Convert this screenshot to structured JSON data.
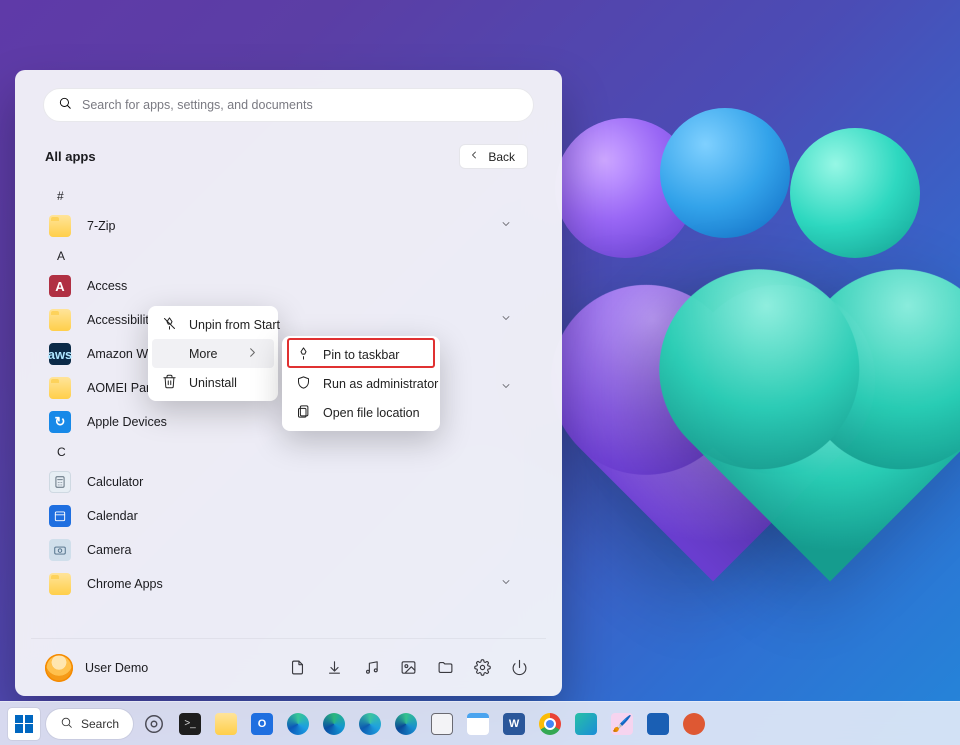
{
  "search": {
    "placeholder": "Search for apps, settings, and documents"
  },
  "header": {
    "title": "All apps",
    "back": "Back"
  },
  "letters": {
    "hash": "#",
    "a": "A",
    "c": "C"
  },
  "apps": {
    "sevenzip": "7-Zip",
    "access": "Access",
    "accessibility": "Accessibility",
    "amazon": "Amazon Workspaces",
    "aomei": "AOMEI Partition Assistant",
    "apple": "Apple Devices",
    "calculator": "Calculator",
    "calendar": "Calendar",
    "camera": "Camera",
    "chromeapps": "Chrome Apps"
  },
  "ctx": {
    "unpin": "Unpin from Start",
    "more": "More",
    "uninstall": "Uninstall",
    "pinTaskbar": "Pin to taskbar",
    "runAdmin": "Run as administrator",
    "openLoc": "Open file location"
  },
  "user": {
    "name": "User Demo"
  },
  "taskbar": {
    "search": "Search"
  },
  "icons": {
    "access": "A",
    "amazon": "aws",
    "apple": "↻"
  }
}
